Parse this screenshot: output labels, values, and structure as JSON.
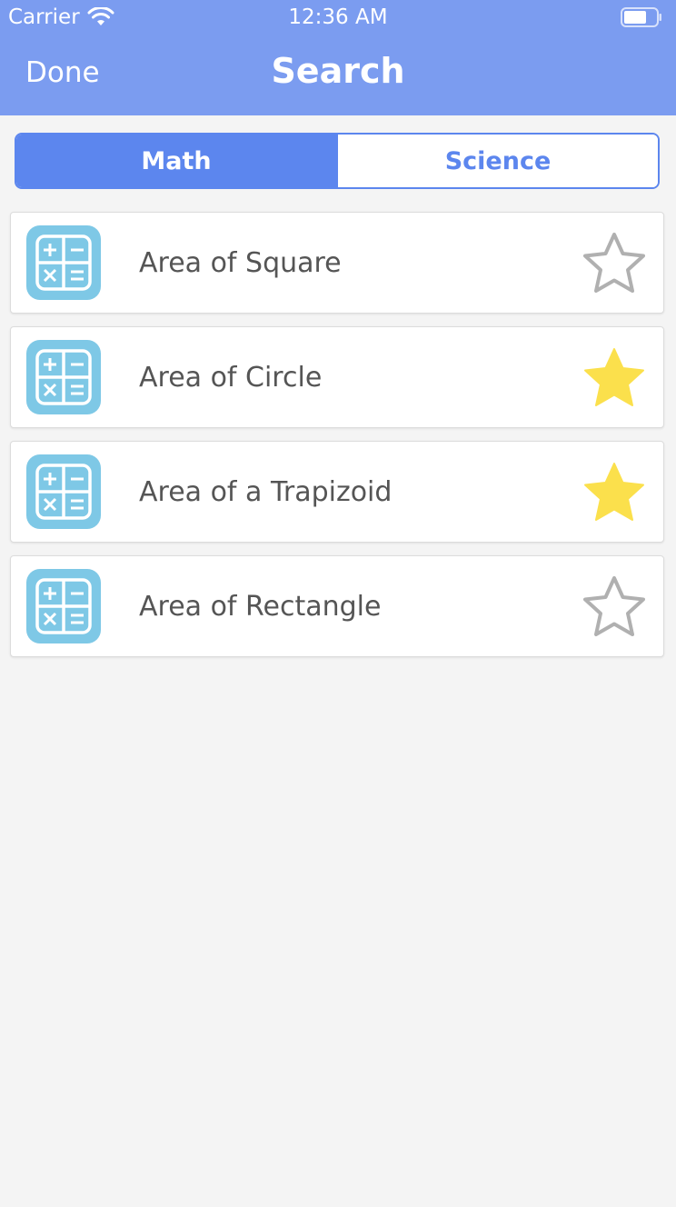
{
  "status_bar": {
    "carrier": "Carrier",
    "time": "12:36 AM",
    "wifi_icon": "wifi-icon",
    "battery_icon": "battery-icon"
  },
  "nav": {
    "done_label": "Done",
    "title": "Search"
  },
  "segments": [
    {
      "label": "Math",
      "selected": true
    },
    {
      "label": "Science",
      "selected": false
    }
  ],
  "items": [
    {
      "label": "Area of Square",
      "icon": "calculator-icon",
      "favorite": false
    },
    {
      "label": "Area of Circle",
      "icon": "calculator-icon",
      "favorite": true
    },
    {
      "label": "Area of a Trapizoid",
      "icon": "calculator-icon",
      "favorite": true
    },
    {
      "label": "Area of Rectangle",
      "icon": "calculator-icon",
      "favorite": false
    }
  ],
  "colors": {
    "nav_bar": "#7b9cf0",
    "segment_accent": "#5c86ee",
    "icon_tile": "#7ec8e6",
    "star_filled": "#fbe04c",
    "star_empty": "#b0b0b0",
    "background": "#f4f4f4"
  }
}
